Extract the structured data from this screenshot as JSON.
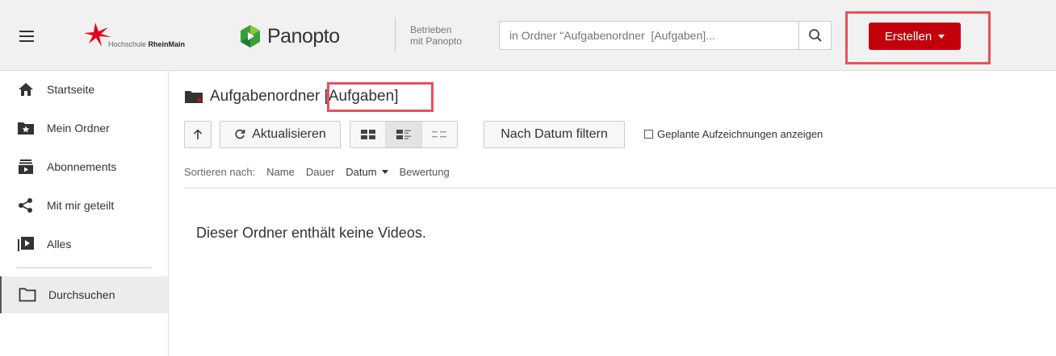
{
  "header": {
    "logo_institution_light": "Hochschule ",
    "logo_institution_bold": "RheinMain",
    "panopto_brand": "Panopto",
    "powered_line1": "Betrieben",
    "powered_line2": "mit Panopto",
    "search_placeholder": "in Ordner \"Aufgabenordner  [Aufgaben]...",
    "create_label": "Erstellen"
  },
  "sidebar": {
    "items": [
      {
        "label": "Startseite",
        "icon": "home-icon"
      },
      {
        "label": "Mein Ordner",
        "icon": "star-folder-icon"
      },
      {
        "label": "Abonnements",
        "icon": "subscriptions-icon"
      },
      {
        "label": "Mit mir geteilt",
        "icon": "share-icon"
      },
      {
        "label": "Alles",
        "icon": "video-library-icon"
      },
      {
        "label": "Durchsuchen",
        "icon": "folder-outline-icon"
      }
    ]
  },
  "main": {
    "folder_name": "Aufgabenordner",
    "folder_suffix": "[Aufgaben]",
    "refresh_label": "Aktualisieren",
    "date_filter_label": "Nach Datum filtern",
    "scheduled_label": "Geplante Aufzeichnungen anzeigen",
    "sort_label": "Sortieren nach:",
    "sort_options": [
      "Name",
      "Dauer",
      "Datum",
      "Bewertung"
    ],
    "empty_message": "Dieser Ordner enthält keine Videos."
  },
  "colors": {
    "brand_red": "#c2000b",
    "highlight": "#e8515a"
  }
}
